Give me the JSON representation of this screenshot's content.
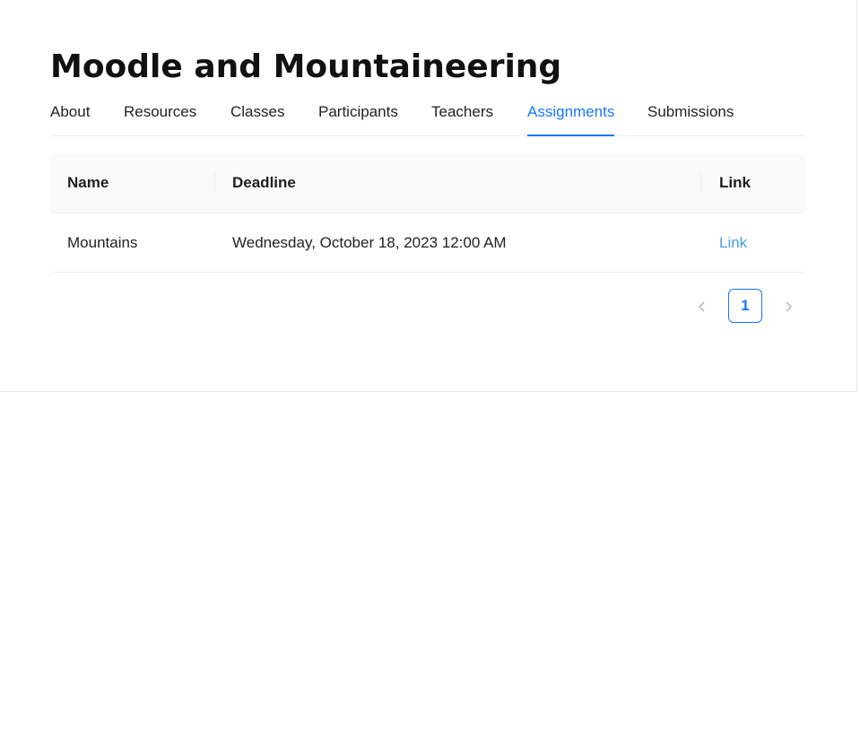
{
  "course": {
    "title": "Moodle and Mountaineering"
  },
  "tabs": [
    {
      "label": "About"
    },
    {
      "label": "Resources"
    },
    {
      "label": "Classes"
    },
    {
      "label": "Participants"
    },
    {
      "label": "Teachers"
    },
    {
      "label": "Assignments",
      "active": true
    },
    {
      "label": "Submissions"
    }
  ],
  "table": {
    "columns": [
      "Name",
      "Deadline",
      "Link"
    ],
    "rows": [
      {
        "name": "Mountains",
        "deadline": "Wednesday, October 18, 2023 12:00 AM",
        "link": "Link"
      }
    ]
  },
  "pagination": {
    "current_page": "1"
  },
  "colors": {
    "accent": "#1677ff",
    "link": "#4a9ee6",
    "header_bg": "#fafafa"
  }
}
